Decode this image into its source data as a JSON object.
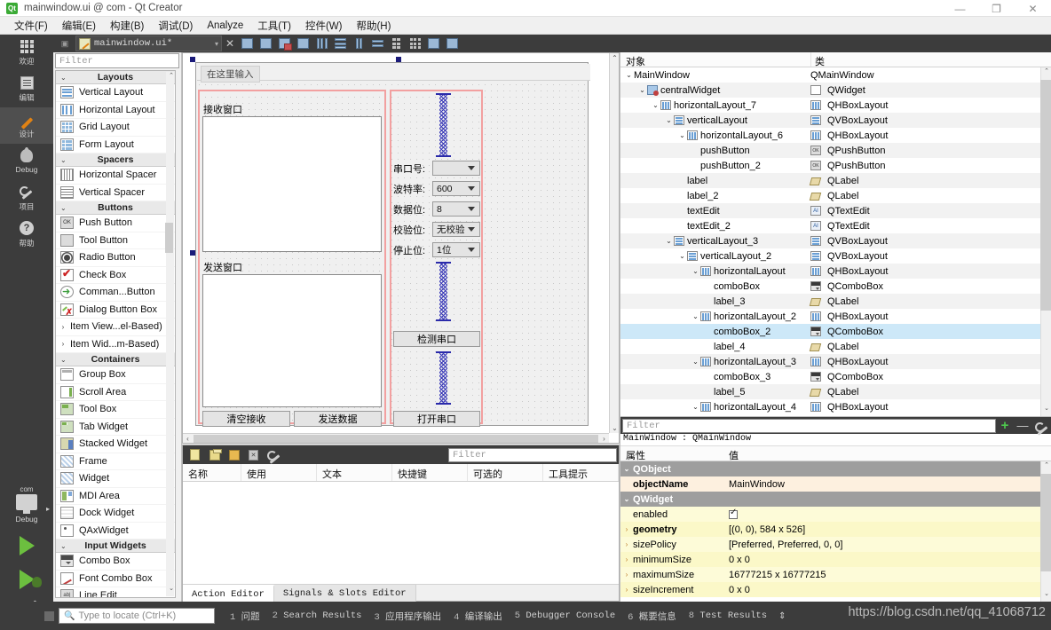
{
  "titlebar": {
    "icon": "qt-logo-icon",
    "title": "mainwindow.ui @ com - Qt Creator",
    "minimize": "—",
    "maximize": "❐",
    "close": "✕"
  },
  "menubar": {
    "items": [
      {
        "label": "文件(F)"
      },
      {
        "label": "编辑(E)"
      },
      {
        "label": "构建(B)"
      },
      {
        "label": "调试(D)"
      },
      {
        "label": "Analyze"
      },
      {
        "label": "工具(T)"
      },
      {
        "label": "控件(W)"
      },
      {
        "label": "帮助(H)"
      }
    ]
  },
  "activitybar": {
    "items": [
      {
        "label": "欢迎",
        "icon": "grid-icon",
        "active": false
      },
      {
        "label": "编辑",
        "icon": "document-icon",
        "active": false
      },
      {
        "label": "设计",
        "icon": "pencil-icon",
        "active": true
      },
      {
        "label": "Debug",
        "icon": "bug-icon",
        "active": false
      },
      {
        "label": "项目",
        "icon": "wrench-icon",
        "active": false
      },
      {
        "label": "帮助",
        "icon": "question-icon",
        "active": false
      }
    ],
    "kit": {
      "project": "com",
      "config": "Debug"
    }
  },
  "toolstrip": {
    "file_name": "mainwindow.ui*",
    "caret": "▾",
    "close": "✕"
  },
  "widgetbox": {
    "filter_placeholder": "Filter",
    "groups": [
      {
        "name": "Layouts",
        "chev": "⌄",
        "items": [
          {
            "label": "Vertical Layout",
            "icon": "vertical-layout-icon"
          },
          {
            "label": "Horizontal Layout",
            "icon": "horizontal-layout-icon"
          },
          {
            "label": "Grid Layout",
            "icon": "grid-layout-icon"
          },
          {
            "label": "Form Layout",
            "icon": "form-layout-icon"
          }
        ]
      },
      {
        "name": "Spacers",
        "chev": "⌄",
        "items": [
          {
            "label": "Horizontal Spacer",
            "icon": "horizontal-spacer-icon"
          },
          {
            "label": "Vertical Spacer",
            "icon": "vertical-spacer-icon"
          }
        ]
      },
      {
        "name": "Buttons",
        "chev": "⌄",
        "items": [
          {
            "label": "Push Button",
            "icon": "push-button-icon"
          },
          {
            "label": "Tool Button",
            "icon": "tool-button-icon"
          },
          {
            "label": "Radio Button",
            "icon": "radio-button-icon"
          },
          {
            "label": "Check Box",
            "icon": "check-box-icon"
          },
          {
            "label": "Comman...Button",
            "icon": "command-link-button-icon"
          },
          {
            "label": "Dialog Button Box",
            "icon": "dialog-button-box-icon"
          }
        ]
      },
      {
        "name": "Item View...el-Based)",
        "chev": "›",
        "collapsed": true,
        "items": []
      },
      {
        "name": "Item Wid...m-Based)",
        "chev": "›",
        "collapsed": true,
        "items": []
      },
      {
        "name": "Containers",
        "chev": "⌄",
        "items": [
          {
            "label": "Group Box",
            "icon": "group-box-icon"
          },
          {
            "label": "Scroll Area",
            "icon": "scroll-area-icon"
          },
          {
            "label": "Tool Box",
            "icon": "tool-box-icon"
          },
          {
            "label": "Tab Widget",
            "icon": "tab-widget-icon"
          },
          {
            "label": "Stacked Widget",
            "icon": "stacked-widget-icon"
          },
          {
            "label": "Frame",
            "icon": "frame-icon"
          },
          {
            "label": "Widget",
            "icon": "widget-icon"
          },
          {
            "label": "MDI Area",
            "icon": "mdi-area-icon"
          },
          {
            "label": "Dock Widget",
            "icon": "dock-widget-icon"
          },
          {
            "label": "QAxWidget",
            "icon": "qax-widget-icon"
          }
        ]
      },
      {
        "name": "Input Widgets",
        "chev": "⌄",
        "items": [
          {
            "label": "Combo Box",
            "icon": "combo-box-icon"
          },
          {
            "label": "Font Combo Box",
            "icon": "font-combo-box-icon"
          },
          {
            "label": "Line Edit",
            "icon": "line-edit-icon"
          }
        ]
      }
    ]
  },
  "designer": {
    "menu_placeholder": "在这里输入",
    "labels": {
      "receive_window": "接收窗口",
      "send_window": "发送窗口"
    },
    "combos": [
      {
        "label": "串口号:",
        "value": ""
      },
      {
        "label": "波特率:",
        "value": "600"
      },
      {
        "label": "数据位:",
        "value": "8"
      },
      {
        "label": "校验位:",
        "value": "无校验"
      },
      {
        "label": "停止位:",
        "value": "1位"
      }
    ],
    "buttons": {
      "clear_receive": "清空接收",
      "send_data": "发送数据",
      "detect_port": "检测串口",
      "open_port": "打开串口"
    }
  },
  "action_editor": {
    "filter_placeholder": "Filter",
    "columns": [
      "名称",
      "使用",
      "文本",
      "快捷键",
      "可选的",
      "工具提示"
    ],
    "rows": [],
    "tabs": [
      {
        "label": "Action Editor",
        "active": true
      },
      {
        "label": "Signals & Slots Editor",
        "active": false
      }
    ]
  },
  "object_inspector": {
    "columns": {
      "object": "对象",
      "class": "类"
    },
    "rows": [
      {
        "indent": 0,
        "chev": "⌄",
        "icon": "none",
        "name": "MainWindow",
        "class": "QMainWindow",
        "class_icon": "none",
        "selected": false
      },
      {
        "indent": 1,
        "chev": "⌄",
        "icon": "central",
        "name": "centralWidget",
        "class": "QWidget",
        "class_icon": "frame",
        "selected": false
      },
      {
        "indent": 2,
        "chev": "⌄",
        "icon": "hbox",
        "name": "horizontalLayout_7",
        "class": "QHBoxLayout",
        "class_icon": "hbox",
        "selected": false
      },
      {
        "indent": 3,
        "chev": "⌄",
        "icon": "vbox",
        "name": "verticalLayout",
        "class": "QVBoxLayout",
        "class_icon": "vbox",
        "selected": false
      },
      {
        "indent": 4,
        "chev": "⌄",
        "icon": "hbox",
        "name": "horizontalLayout_6",
        "class": "QHBoxLayout",
        "class_icon": "hbox",
        "selected": false
      },
      {
        "indent": 5,
        "chev": "",
        "icon": "none",
        "name": "pushButton",
        "class": "QPushButton",
        "class_icon": "push",
        "selected": false
      },
      {
        "indent": 5,
        "chev": "",
        "icon": "none",
        "name": "pushButton_2",
        "class": "QPushButton",
        "class_icon": "push",
        "selected": false
      },
      {
        "indent": 4,
        "chev": "",
        "icon": "none",
        "name": "label",
        "class": "QLabel",
        "class_icon": "label",
        "selected": false
      },
      {
        "indent": 4,
        "chev": "",
        "icon": "none",
        "name": "label_2",
        "class": "QLabel",
        "class_icon": "label",
        "selected": false
      },
      {
        "indent": 4,
        "chev": "",
        "icon": "none",
        "name": "textEdit",
        "class": "QTextEdit",
        "class_icon": "text",
        "selected": false
      },
      {
        "indent": 4,
        "chev": "",
        "icon": "none",
        "name": "textEdit_2",
        "class": "QTextEdit",
        "class_icon": "text",
        "selected": false
      },
      {
        "indent": 3,
        "chev": "⌄",
        "icon": "vbox",
        "name": "verticalLayout_3",
        "class": "QVBoxLayout",
        "class_icon": "vbox",
        "selected": false
      },
      {
        "indent": 4,
        "chev": "⌄",
        "icon": "vbox",
        "name": "verticalLayout_2",
        "class": "QVBoxLayout",
        "class_icon": "vbox",
        "selected": false
      },
      {
        "indent": 5,
        "chev": "⌄",
        "icon": "hbox",
        "name": "horizontalLayout",
        "class": "QHBoxLayout",
        "class_icon": "hbox",
        "selected": false
      },
      {
        "indent": 6,
        "chev": "",
        "icon": "none",
        "name": "comboBox",
        "class": "QComboBox",
        "class_icon": "combo",
        "selected": false
      },
      {
        "indent": 6,
        "chev": "",
        "icon": "none",
        "name": "label_3",
        "class": "QLabel",
        "class_icon": "label",
        "selected": false
      },
      {
        "indent": 5,
        "chev": "⌄",
        "icon": "hbox",
        "name": "horizontalLayout_2",
        "class": "QHBoxLayout",
        "class_icon": "hbox",
        "selected": false
      },
      {
        "indent": 6,
        "chev": "",
        "icon": "none",
        "name": "comboBox_2",
        "class": "QComboBox",
        "class_icon": "combo",
        "selected": true
      },
      {
        "indent": 6,
        "chev": "",
        "icon": "none",
        "name": "label_4",
        "class": "QLabel",
        "class_icon": "label",
        "selected": false
      },
      {
        "indent": 5,
        "chev": "⌄",
        "icon": "hbox",
        "name": "horizontalLayout_3",
        "class": "QHBoxLayout",
        "class_icon": "hbox",
        "selected": false
      },
      {
        "indent": 6,
        "chev": "",
        "icon": "none",
        "name": "comboBox_3",
        "class": "QComboBox",
        "class_icon": "combo",
        "selected": false
      },
      {
        "indent": 6,
        "chev": "",
        "icon": "none",
        "name": "label_5",
        "class": "QLabel",
        "class_icon": "label",
        "selected": false
      },
      {
        "indent": 5,
        "chev": "⌄",
        "icon": "hbox",
        "name": "horizontalLayout_4",
        "class": "QHBoxLayout",
        "class_icon": "hbox",
        "selected": false
      }
    ]
  },
  "property_editor": {
    "filter_placeholder": "Filter",
    "add_label": "+",
    "remove_label": "—",
    "config_label": "configure-icon",
    "object_line": "MainWindow : QMainWindow",
    "columns": {
      "property": "属性",
      "value": "值"
    },
    "rows": [
      {
        "type": "group",
        "name": "QObject",
        "value": "",
        "chev": "⌄"
      },
      {
        "type": "prop",
        "name": "objectName",
        "value": "MainWindow",
        "chev": "",
        "bold": true,
        "shade": "y0"
      },
      {
        "type": "group",
        "name": "QWidget",
        "value": "",
        "chev": "⌄"
      },
      {
        "type": "prop",
        "name": "enabled",
        "value": "",
        "chev": "",
        "checkbox": true,
        "shade": "y1"
      },
      {
        "type": "prop",
        "name": "geometry",
        "value": "[(0, 0), 584 x 526]",
        "chev": "›",
        "bold": true,
        "shade": "y2"
      },
      {
        "type": "prop",
        "name": "sizePolicy",
        "value": "[Preferred, Preferred, 0, 0]",
        "chev": "›",
        "shade": "y1"
      },
      {
        "type": "prop",
        "name": "minimumSize",
        "value": "0 x 0",
        "chev": "›",
        "shade": "y2"
      },
      {
        "type": "prop",
        "name": "maximumSize",
        "value": "16777215 x 16777215",
        "chev": "›",
        "shade": "y1"
      },
      {
        "type": "prop",
        "name": "sizeIncrement",
        "value": "0 x 0",
        "chev": "›",
        "shade": "y2"
      }
    ]
  },
  "statusbar": {
    "locate_placeholder": "Type to locate (Ctrl+K)",
    "items": [
      {
        "num": "1",
        "label": "问题"
      },
      {
        "num": "2",
        "label": "Search Results"
      },
      {
        "num": "3",
        "label": "应用程序输出"
      },
      {
        "num": "4",
        "label": "编译输出"
      },
      {
        "num": "5",
        "label": "Debugger Console"
      },
      {
        "num": "6",
        "label": "概要信息"
      },
      {
        "num": "8",
        "label": "Test Results"
      }
    ],
    "updown": "⇕",
    "watermark": "https://blog.csdn.net/qq_41068712"
  },
  "colors": {
    "dark_chrome": "#3c3c3c",
    "selection_blue": "#cde8f8",
    "red_layout": "#f2a0a0",
    "spring_blue": "#3a3ab8",
    "accent_green": "#4ec94e"
  }
}
